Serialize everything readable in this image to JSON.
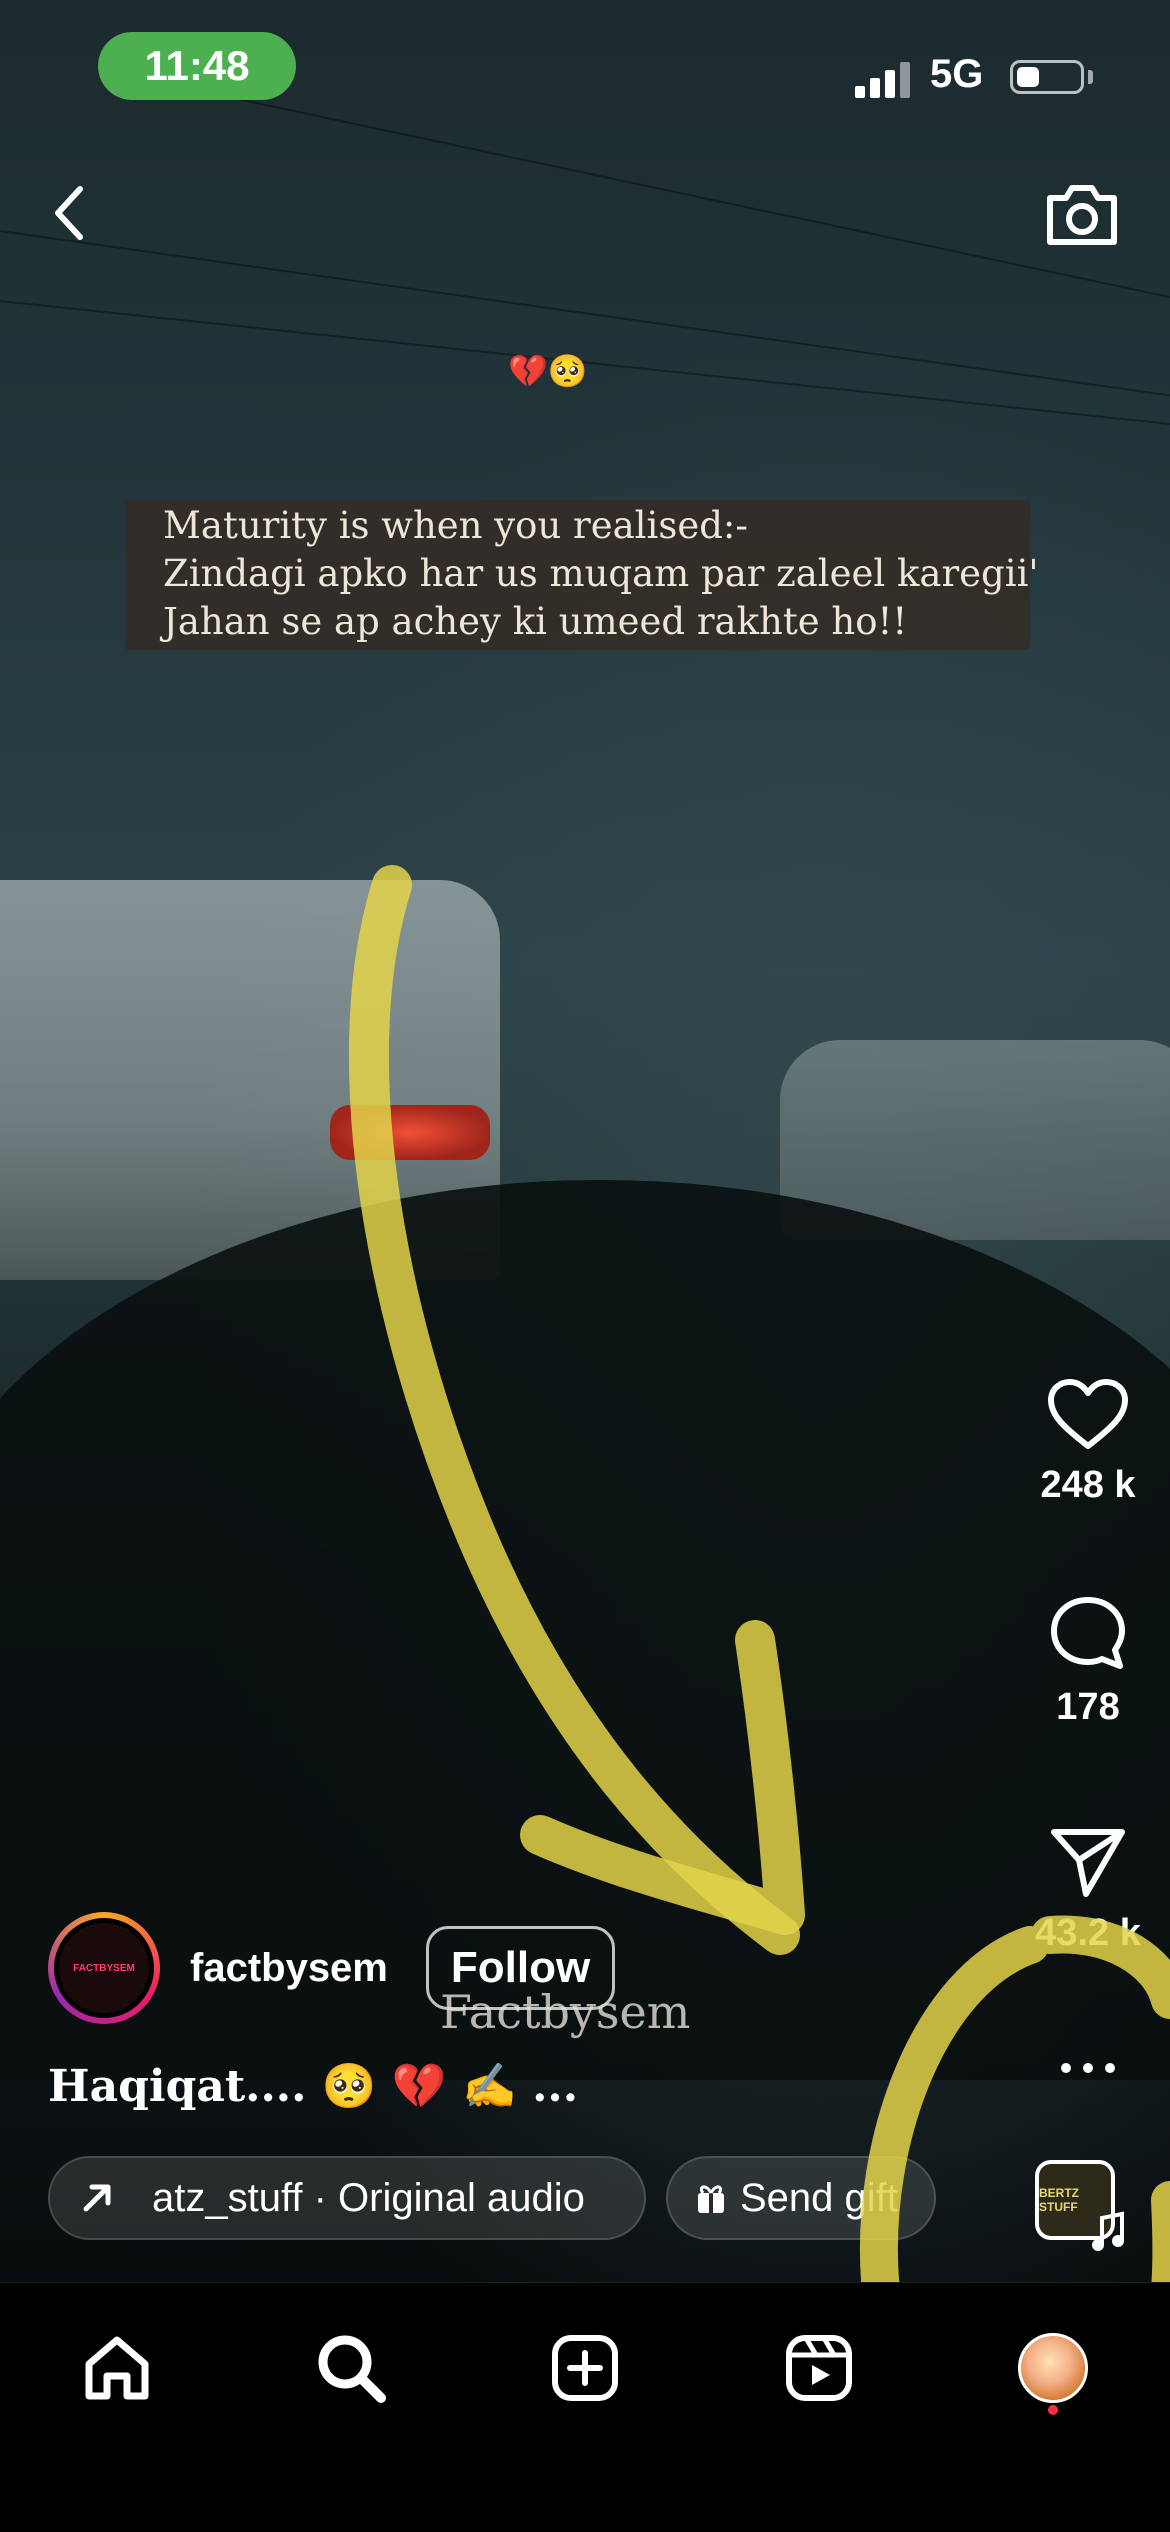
{
  "status_bar": {
    "time": "11:48",
    "network": "5G"
  },
  "reel": {
    "top_emojis": "💔🥺",
    "caption_card": {
      "line1": "Maturity is when you realised:-",
      "line2": "Zindagi apko har us muqam par zaleel karegii'",
      "line3": "Jahan se ap achey ki umeed rakhte ho!!"
    },
    "watermark": "Factbysem",
    "likes": "248 k",
    "comments": "178",
    "shares": "43.2 k",
    "author": {
      "username": "factbysem",
      "avatar_text": "FACTBYSEM",
      "follow_label": "Follow"
    },
    "post_caption": "Haqiqat.... 🥺 💔 ✍️ ...",
    "audio_label": "atz_stuff · Original audio",
    "gift_label": "Send gift",
    "audio_thumb_text": "BERTZ STUFF"
  },
  "icons": {
    "back": "chevron-left-icon",
    "camera": "camera-icon",
    "like": "heart-icon",
    "comment": "comment-bubble-icon",
    "share": "paper-plane-icon",
    "more": "more-horizontal-icon",
    "audio_arrow": "arrow-up-right-icon",
    "gift": "gift-icon",
    "music": "music-note-icon"
  },
  "bottom_nav": [
    {
      "name": "home",
      "icon": "home-icon"
    },
    {
      "name": "search",
      "icon": "search-icon"
    },
    {
      "name": "create",
      "icon": "plus-square-icon"
    },
    {
      "name": "reels",
      "icon": "reels-icon"
    },
    {
      "name": "profile",
      "icon": "profile-avatar"
    }
  ],
  "colors": {
    "time_pill": "#4caf50",
    "annotation": "#e3d34a",
    "notification_dot": "#ff3040"
  }
}
